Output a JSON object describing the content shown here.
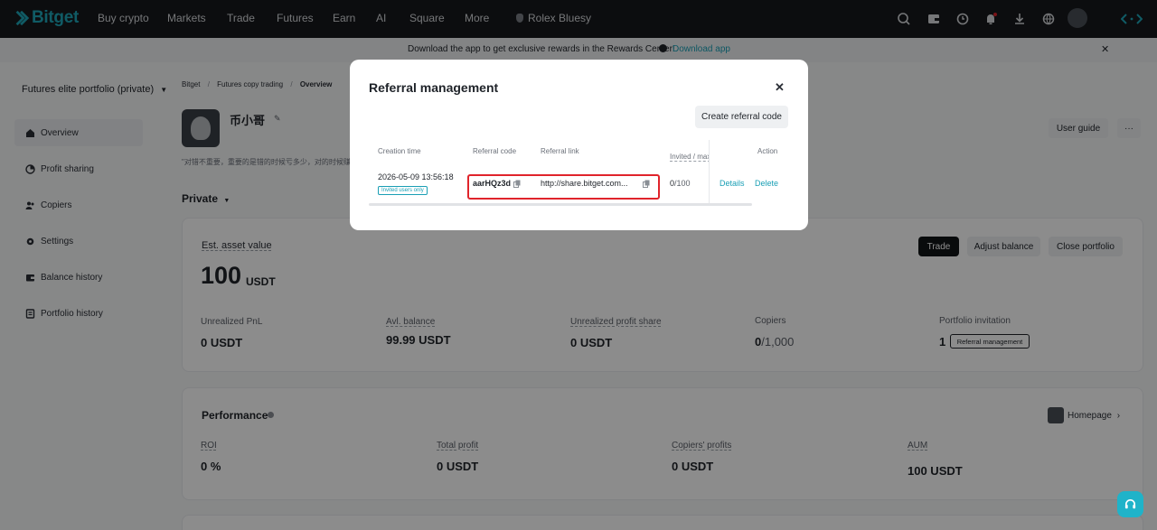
{
  "nav": {
    "logo": "Bitget",
    "items": [
      "Buy crypto",
      "Markets",
      "Trade",
      "Futures",
      "Earn",
      "AI",
      "Square",
      "More"
    ],
    "user_label": "Rolex Bluesy"
  },
  "banner": {
    "text": "Download the app to get exclusive rewards in the Rewards Center!",
    "link": "Download app"
  },
  "sidebar": {
    "portfolio_select": "Futures elite portfolio (private)",
    "items": [
      {
        "label": "Overview",
        "icon": "home-icon"
      },
      {
        "label": "Profit sharing",
        "icon": "profit-icon"
      },
      {
        "label": "Copiers",
        "icon": "users-icon"
      },
      {
        "label": "Settings",
        "icon": "gear-icon"
      },
      {
        "label": "Balance history",
        "icon": "wallet-icon"
      },
      {
        "label": "Portfolio history",
        "icon": "history-icon"
      }
    ]
  },
  "breadcrumb": [
    "Bitget",
    "Futures copy trading",
    "Overview"
  ],
  "profile": {
    "name": "币小哥",
    "bio": "\"对错不重要，重要的是错的时候亏多少，对的时候赚",
    "visibility": "Private",
    "user_guide": "User guide",
    "more": "···"
  },
  "asset": {
    "title": "Est. asset value",
    "value": "100",
    "unit": "USDT",
    "buttons": [
      "Trade",
      "Adjust balance",
      "Close portfolio"
    ],
    "stats": [
      {
        "label": "Unrealized PnL",
        "value": "0 USDT"
      },
      {
        "label": "Avl. balance",
        "value": "99.99 USDT"
      },
      {
        "label": "Unrealized profit share",
        "value": "0 USDT"
      },
      {
        "label": "Copiers",
        "value": "0",
        "value2": "/1,000"
      },
      {
        "label": "Portfolio invitation",
        "value": "1",
        "button": "Referral management"
      }
    ]
  },
  "performance": {
    "title": "Performance",
    "homepage": "Homepage",
    "stats": [
      {
        "label": "ROI",
        "value": "0 %"
      },
      {
        "label": "Total profit",
        "value": "0 USDT"
      },
      {
        "label": "Copiers' profits",
        "value": "0 USDT"
      },
      {
        "label": "AUM",
        "value": "100 USDT"
      }
    ]
  },
  "modal": {
    "title": "Referral management",
    "create_button": "Create referral code",
    "columns": [
      "Creation time",
      "Referral code",
      "Referral link",
      "Invited / max",
      "Action"
    ],
    "row": {
      "time": "2026-05-09 13:56:18",
      "tag": "Invited users only",
      "code": "aarHQz3d",
      "link": "http://share.bitget.com...",
      "invited": "0",
      "max": "/100",
      "details": "Details",
      "delete": "Delete"
    }
  },
  "colors": {
    "accent": "#1a9fb5",
    "highlight": "#e0242b"
  }
}
